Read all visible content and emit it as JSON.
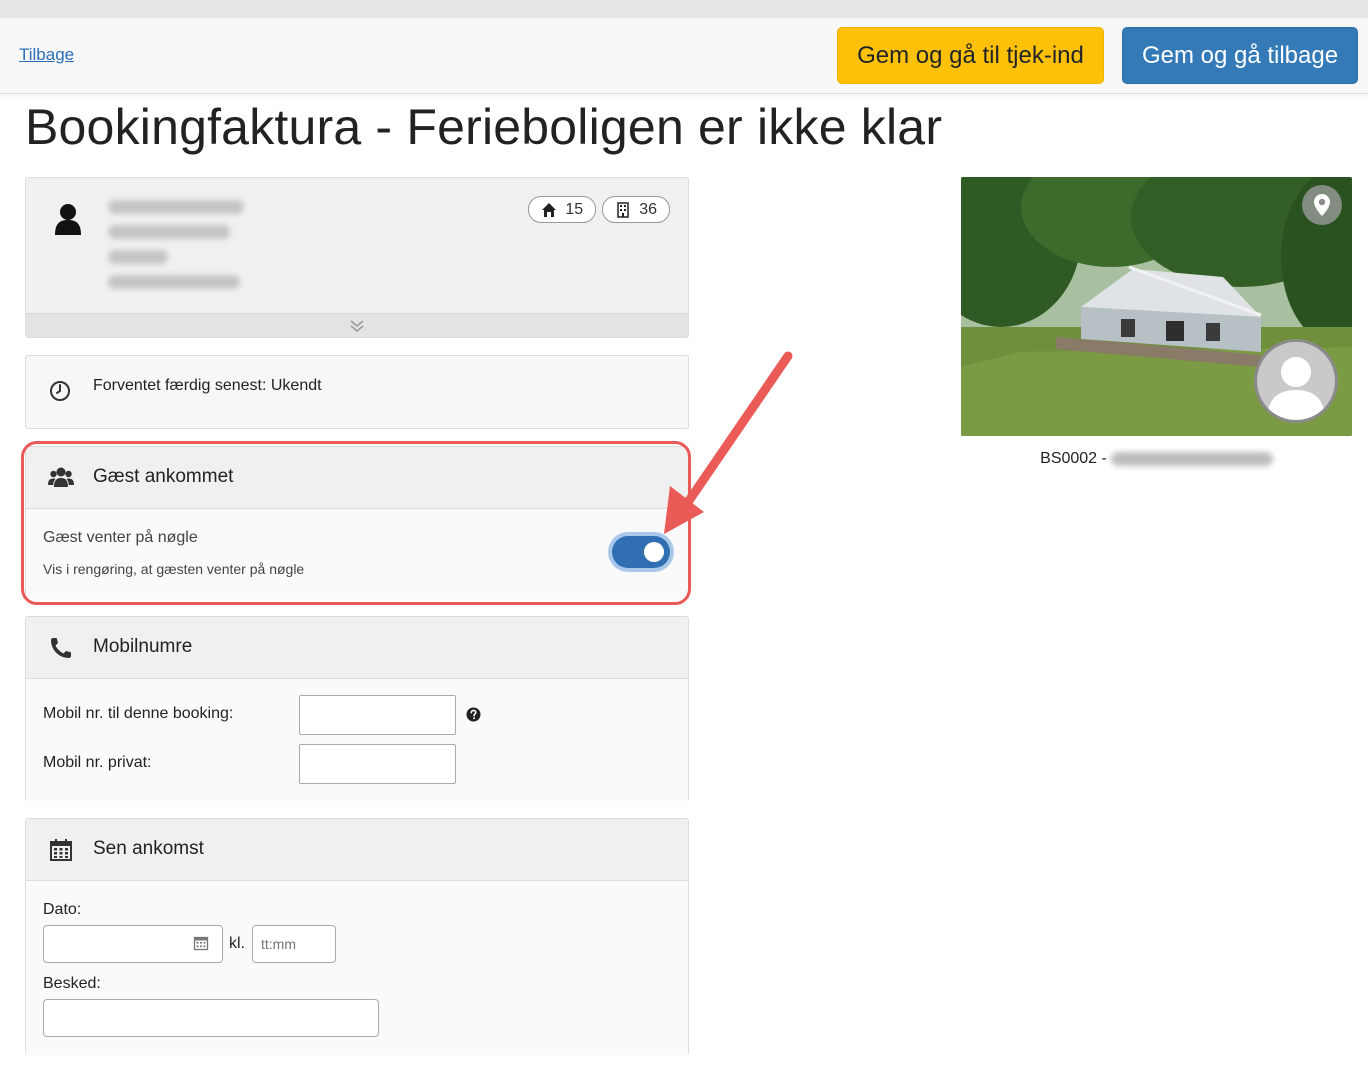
{
  "topbar": {
    "back_label": "Tilbage",
    "checkin_button": "Gem og gå til tjek-ind",
    "back_button": "Gem og gå tilbage"
  },
  "page_title": "Bookingfaktura - Ferieboligen er ikke klar",
  "guest": {
    "badges": [
      {
        "icon": "home-icon",
        "value": "15"
      },
      {
        "icon": "building-icon",
        "value": "36"
      }
    ]
  },
  "status": {
    "text": "Forventet færdig senest: Ukendt"
  },
  "arrived": {
    "title": "Gæst ankommet",
    "wait_label": "Gæst venter på nøgle",
    "wait_help": "Vis i rengøring, at gæsten venter på nøgle",
    "toggle_on": true
  },
  "mobile": {
    "title": "Mobilnumre",
    "booking_label": "Mobil nr. til denne booking:",
    "private_label": "Mobil nr. privat:",
    "booking_value": "",
    "private_value": ""
  },
  "late": {
    "title": "Sen ankomst",
    "date_label": "Dato:",
    "time_separator": "kl.",
    "time_placeholder": "tt:mm",
    "message_label": "Besked:"
  },
  "property": {
    "code": "BS0002 -"
  },
  "colors": {
    "accent": "#337ab7",
    "warning": "#ffc107",
    "highlight": "#ea5a57",
    "toggle": "#2f6fb2"
  }
}
